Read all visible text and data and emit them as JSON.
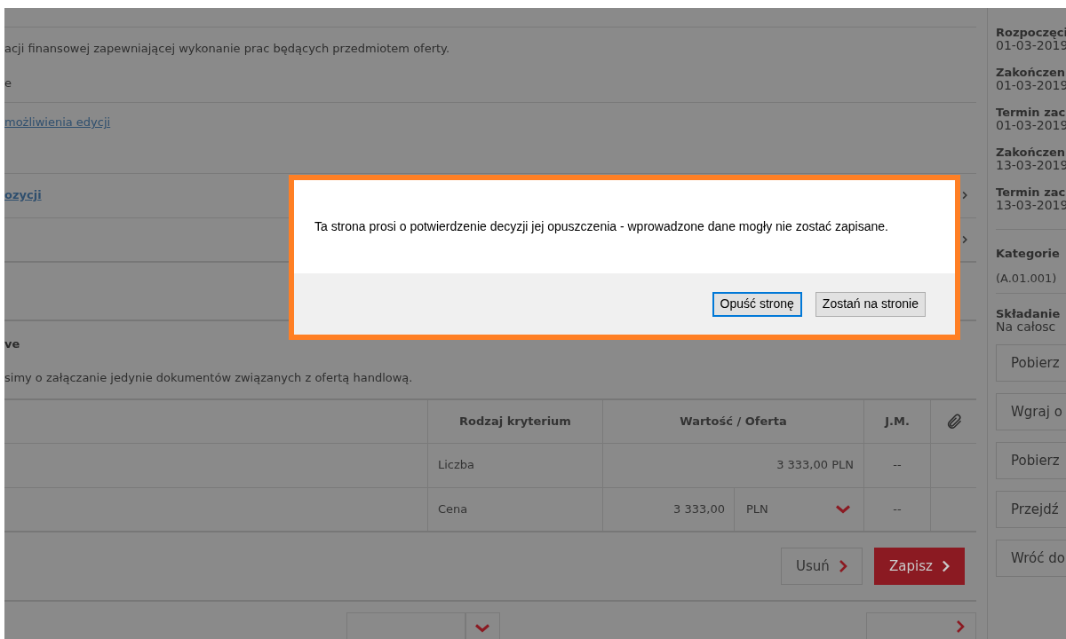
{
  "content": {
    "intro_text": "acji finansowej zapewniającej wykonanie prac będących przedmiotem oferty.",
    "intro_text_2": "e",
    "edit_link": "możliwienia edycji",
    "positions_link": "ozycji"
  },
  "attachments": {
    "heading": "ve",
    "note": "simy o załączanie jedynie dokumentów związanych z ofertą handlową."
  },
  "table": {
    "columns": [
      {
        "label": "Rodzaj kryterium"
      },
      {
        "label": "Wartość / Oferta"
      },
      {
        "label": "J.M."
      }
    ],
    "rows": [
      {
        "kind": "plain",
        "column_2": "Liczba",
        "value": "3 333,00 PLN",
        "unit": "--"
      },
      {
        "kind": "currency",
        "column_2": "Cena",
        "value": "3 333,00",
        "currency": "PLN",
        "unit": "--"
      }
    ]
  },
  "actions": [
    {
      "label": "Usuń",
      "kind": "secondary"
    },
    {
      "label": "Zapisz",
      "kind": "primary"
    }
  ],
  "sidebar": {
    "dates": [
      {
        "label": "Rozpoczęci",
        "value": "01-03-2019"
      },
      {
        "label": "Zakończen",
        "value": "01-03-2019"
      },
      {
        "label": "Termin zac",
        "value": "01-03-2019"
      },
      {
        "label": "Zakończen",
        "value": "13-03-2019"
      },
      {
        "label": "Termin zac",
        "value": "13-03-2019"
      }
    ],
    "category": {
      "label": "Kategorie",
      "value": "(A.01.001)"
    },
    "submission": {
      "label": "Składanie",
      "value": "Na całosc"
    },
    "buttons": [
      "Pobierz",
      "Wgraj o",
      "Pobierz",
      "Przejdź",
      "Wróć do"
    ]
  },
  "dialog": {
    "message": "Ta strona prosi o potwierdzenie decyzji jej opuszczenia - wprowadzone dane mogły nie zostać zapisane.",
    "buttons": [
      {
        "label": "Opuść stronę",
        "focused": true
      },
      {
        "label": "Zostań na stronie",
        "focused": false
      }
    ]
  }
}
